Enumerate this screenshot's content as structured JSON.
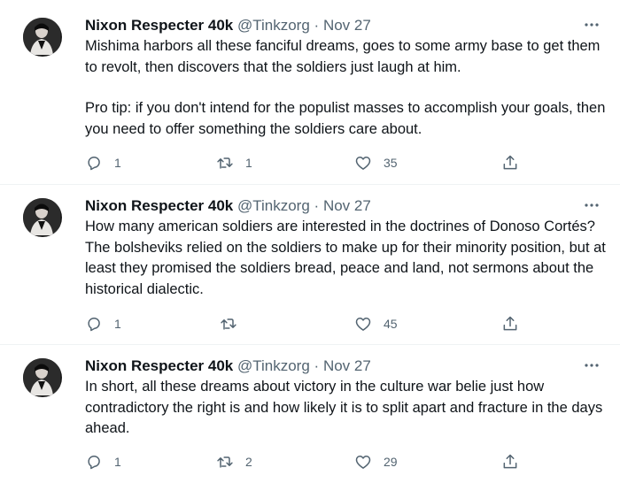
{
  "tweets": [
    {
      "author": {
        "name": "Nixon Respecter 40k",
        "handle": "@Tinkzorg"
      },
      "separator": "·",
      "date": "Nov 27",
      "paragraphs": [
        "Mishima harbors all these fanciful dreams, goes to some army base to get them to revolt, then discovers that the soldiers just laugh at him.",
        "Pro tip: if you don't intend for the populist masses to accomplish your goals, then you need to offer something the soldiers care about."
      ],
      "actions": {
        "replies": "1",
        "retweets": "1",
        "likes": "35"
      }
    },
    {
      "author": {
        "name": "Nixon Respecter 40k",
        "handle": "@Tinkzorg"
      },
      "separator": "·",
      "date": "Nov 27",
      "paragraphs": [
        "How many american soldiers are interested in the doctrines of Donoso Cortés? The bolsheviks relied on the soldiers to make up for their minority position, but at least they promised the soldiers bread, peace and land, not sermons about the historical dialectic."
      ],
      "actions": {
        "replies": "1",
        "retweets": "",
        "likes": "45"
      }
    },
    {
      "author": {
        "name": "Nixon Respecter 40k",
        "handle": "@Tinkzorg"
      },
      "separator": "·",
      "date": "Nov 27",
      "paragraphs": [
        "In short, all these dreams about victory in the culture war belie just how contradictory the right is and how likely it is to split apart and fracture in the days ahead."
      ],
      "actions": {
        "replies": "1",
        "retweets": "2",
        "likes": "29"
      }
    }
  ],
  "icons": {
    "reply": "reply-icon",
    "retweet": "retweet-icon",
    "like": "heart-icon",
    "share": "share-icon",
    "more": "more-options-icon"
  },
  "colors": {
    "text": "#0f1419",
    "secondary": "#536471",
    "divider": "#eff3f4"
  }
}
